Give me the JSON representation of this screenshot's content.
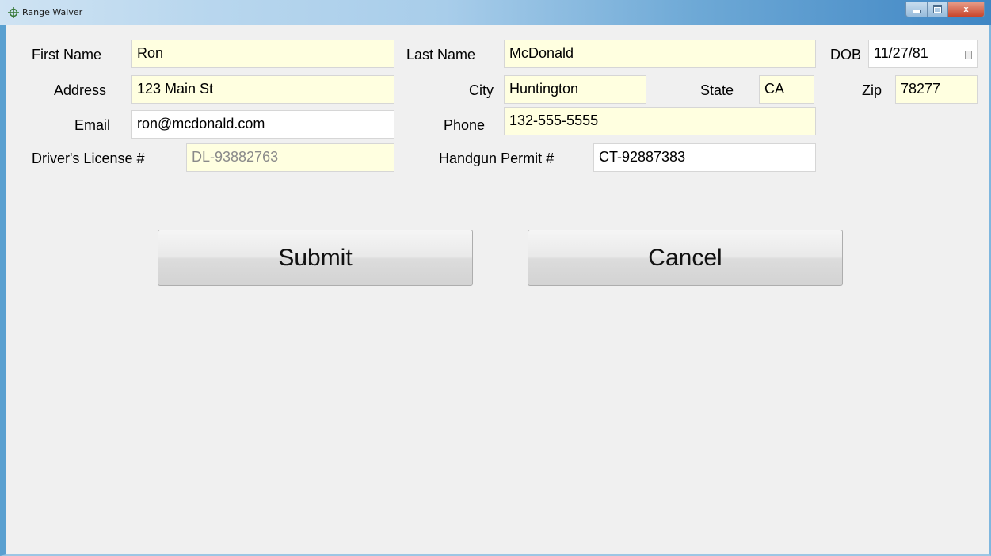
{
  "window": {
    "title": "Range Waiver",
    "controls": {
      "close_label": "x"
    }
  },
  "form": {
    "first_name": {
      "label": "First Name",
      "value": "Ron"
    },
    "last_name": {
      "label": "Last Name",
      "value": "McDonald"
    },
    "dob": {
      "label": "DOB",
      "value": "11/27/81"
    },
    "address": {
      "label": "Address",
      "value": "123 Main St"
    },
    "city": {
      "label": "City",
      "value": "Huntington"
    },
    "state": {
      "label": "State",
      "value": "CA"
    },
    "zip": {
      "label": "Zip",
      "value": "78277"
    },
    "email": {
      "label": "Email",
      "value": "ron@mcdonald.com"
    },
    "phone": {
      "label": "Phone",
      "value": "132-555-5555"
    },
    "drivers_license": {
      "label": "Driver's License #",
      "value": "DL-93882763"
    },
    "handgun_permit": {
      "label": "Handgun Permit #",
      "value": "CT-92887383"
    }
  },
  "buttons": {
    "submit": "Submit",
    "cancel": "Cancel"
  },
  "colors": {
    "required_field_bg": "#ffffe0",
    "optional_field_bg": "#ffffff",
    "window_bg": "#f0f0f0",
    "titlebar_accent": "#3f86c4"
  }
}
